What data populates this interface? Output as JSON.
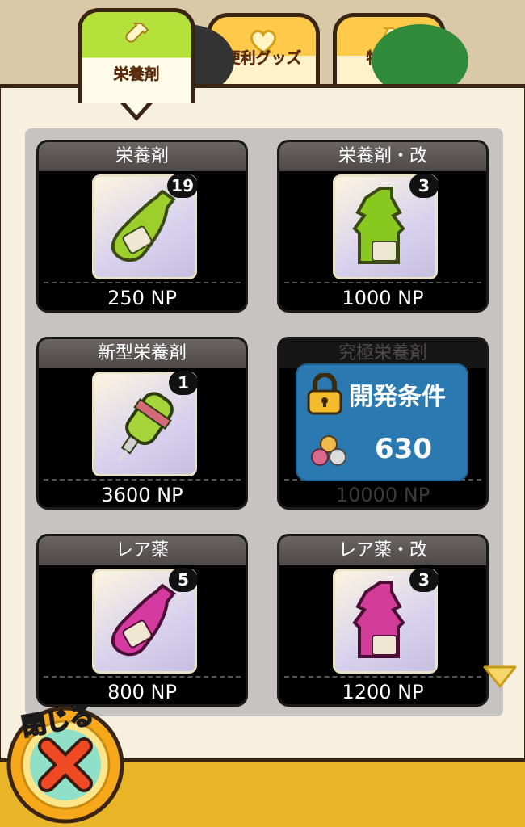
{
  "tabs": [
    {
      "label": "栄養剤",
      "icon": "bottle-icon",
      "active": true
    },
    {
      "label": "便利グッズ",
      "icon": "heart-icon",
      "active": false
    },
    {
      "label": "特殊薬",
      "icon": "potion-icon",
      "active": false
    }
  ],
  "items": [
    {
      "name": "栄養剤",
      "count": "19",
      "price": "250 NP",
      "color": "#9ccf2c",
      "locked": false
    },
    {
      "name": "栄養剤・改",
      "count": "3",
      "price": "1000 NP",
      "color": "#88c81f",
      "locked": false
    },
    {
      "name": "新型栄養剤",
      "count": "1",
      "price": "3600 NP",
      "color": "#a6d53a",
      "locked": false
    },
    {
      "name": "究極栄養剤",
      "count": "",
      "price": "10000 NP",
      "color": "#5a8fb5",
      "locked": true
    },
    {
      "name": "レア薬",
      "count": "5",
      "price": "800 NP",
      "color": "#d53aa0",
      "locked": false
    },
    {
      "name": "レア薬・改",
      "count": "3",
      "price": "1200 NP",
      "color": "#d23b98",
      "locked": false
    }
  ],
  "lock": {
    "title": "開発条件",
    "requirement": "630"
  },
  "close": {
    "label": "閉じる"
  },
  "colors": {
    "panel": "#f7f0de",
    "tab_active": "#b5e13b",
    "tab_inactive": "#ffc94a",
    "lock_bg": "#2a79b0"
  }
}
